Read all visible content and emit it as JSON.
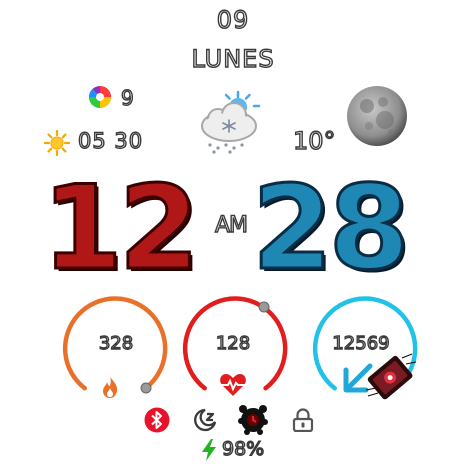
{
  "date": {
    "day_number": "09",
    "day_name": "LUNES"
  },
  "notifications": {
    "count": "9",
    "icon": "notifications-app-icon"
  },
  "sun": {
    "time": "05 30",
    "icon": "sun-icon"
  },
  "weather": {
    "temperature": "10°",
    "icon": "snow-cloud-sun-icon",
    "moon_icon": "moon-phase-icon"
  },
  "clock": {
    "hour": "12",
    "minute": "28",
    "period": "AM"
  },
  "rings": [
    {
      "name": "calories",
      "value": "328",
      "icon": "flame-icon",
      "color": "#e8702a",
      "progress": 0.8
    },
    {
      "name": "heart-rate",
      "value": "128",
      "icon": "heart-pulse-icon",
      "color": "#e21d1d",
      "progress": 0.7
    },
    {
      "name": "distance",
      "value": "12569",
      "icon": "distance-arrow-icon",
      "color": "#22c1e8",
      "progress": 0.75
    }
  ],
  "status": {
    "battery": "98%",
    "icons": [
      "bluetooth-icon",
      "sleep-icon",
      "alarm-icon",
      "lock-icon",
      "charging-icon"
    ]
  }
}
